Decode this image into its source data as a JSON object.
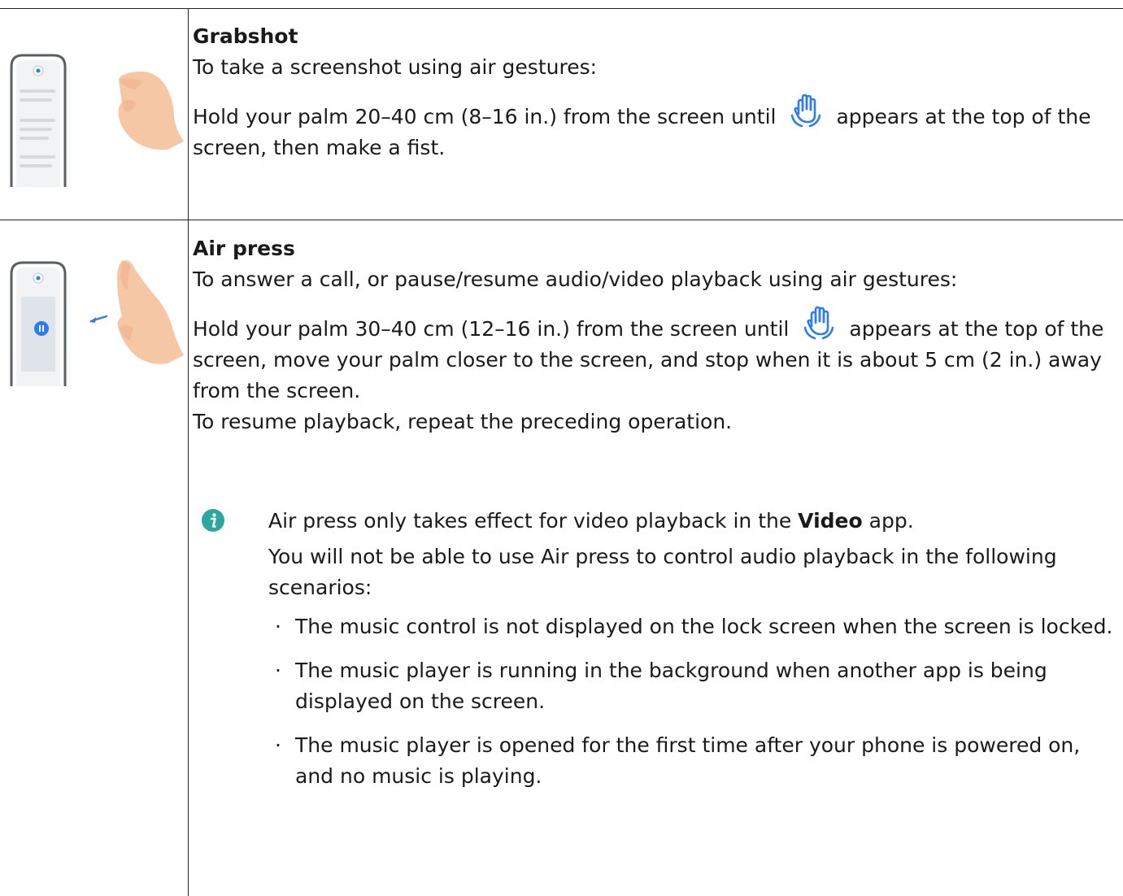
{
  "rows": [
    {
      "title": "Grabshot",
      "intro": "To take a screenshot using air gestures:",
      "step_before": "Hold your palm 20–40 cm (8–16 in.) from the screen until",
      "step_after": "appears at the top of the screen, then make a fist."
    },
    {
      "title": "Air press",
      "intro": "To answer a call, or pause/resume audio/video playback using air gestures:",
      "step_before": "Hold your palm 30–40 cm (12–16 in.) from the screen until",
      "step_after": "appears at the top of the screen, move your palm closer to the screen, and stop when it is about 5 cm (2 in.) away from the screen.",
      "resume": "To resume playback, repeat the preceding operation.",
      "note": {
        "line1_before": "Air press only takes effect for video playback in the ",
        "line1_bold": "Video",
        "line1_after": " app.",
        "line2": "You will not be able to use Air press to control audio playback in the following scenarios:",
        "bullets": [
          "The music control is not displayed on the lock screen when the screen is locked.",
          "The music player is running in the background when another app is being displayed on the screen.",
          "The music player is opened for the first time after your phone is powered on, and no music is playing."
        ]
      }
    }
  ],
  "colors": {
    "accent_blue": "#2f7bf0",
    "info_teal": "#2aa7a0",
    "skin": "#f6c7a5",
    "rule": "#222222"
  },
  "icons": {
    "gesture_hand": "raised-hand-icon",
    "note": "info-icon"
  }
}
